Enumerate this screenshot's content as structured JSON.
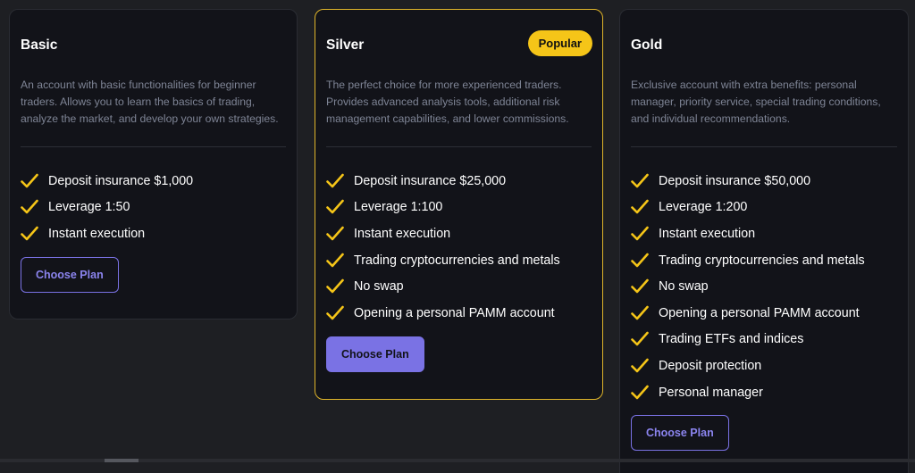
{
  "colors": {
    "background": "#1e1f23",
    "card": "#121319",
    "accent": "#7a72e4",
    "highlight_border": "#e0b52a",
    "badge": "#f5c518",
    "check": "#f5c518",
    "description": "#7e8495"
  },
  "plans": [
    {
      "title": "Basic",
      "description": "An account with basic functionalities for beginner traders. Allows you to learn the basics of trading, analyze the market, and develop your own strategies.",
      "features": [
        "Deposit insurance $1,000",
        "Leverage 1:50",
        "Instant execution"
      ],
      "button": "Choose Plan",
      "button_style": "outline"
    },
    {
      "title": "Silver",
      "badge": "Popular",
      "description": "The perfect choice for more experienced traders. Provides advanced analysis tools, additional risk management capabilities, and lower commissions.",
      "features": [
        "Deposit insurance $25,000",
        "Leverage 1:100",
        "Instant execution",
        "Trading cryptocurrencies and metals",
        "No swap",
        "Opening a personal PAMM account"
      ],
      "button": "Choose Plan",
      "button_style": "filled"
    },
    {
      "title": "Gold",
      "description": "Exclusive account with extra benefits: personal manager, priority service, special trading conditions, and individual recommendations.",
      "features": [
        "Deposit insurance $50,000",
        "Leverage 1:200",
        "Instant execution",
        "Trading cryptocurrencies and metals",
        "No swap",
        "Opening a personal PAMM account",
        "Trading ETFs and indices",
        "Deposit protection",
        "Personal manager"
      ],
      "button": "Choose Plan",
      "button_style": "outline"
    }
  ],
  "check_icon": "check-icon"
}
